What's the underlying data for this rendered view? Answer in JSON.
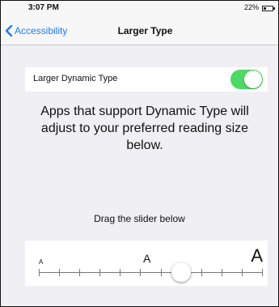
{
  "status_bar": {
    "time": "3:07 PM",
    "battery_percent": "22%"
  },
  "nav": {
    "back_label": "Accessibility",
    "title": "Larger Type",
    "accent_color": "#1a7bff"
  },
  "settings": {
    "toggle_label": "Larger Dynamic Type",
    "toggle_on": true,
    "toggle_color": "#4cd964"
  },
  "description": "Apps that support Dynamic Type will adjust to your preferred reading size below.",
  "slider": {
    "instruction": "Drag the slider below",
    "small_label": "A",
    "medium_label": "A",
    "large_label": "A",
    "steps": 12,
    "selected_step": 7
  }
}
